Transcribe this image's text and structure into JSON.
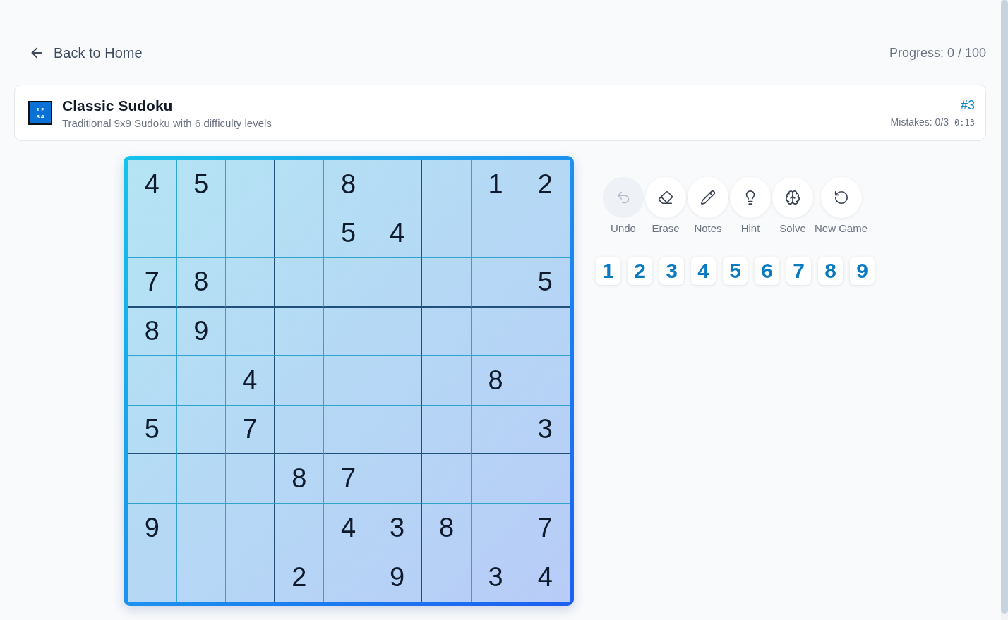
{
  "header": {
    "back_link": "Back to Home",
    "progress": "Progress: 0 / 100"
  },
  "game_card": {
    "logo_lines": [
      "1 2",
      "3 4"
    ],
    "title": "Classic Sudoku",
    "subtitle": "Traditional 9x9 Sudoku with 6 difficulty levels",
    "puzzle_number": "#3",
    "mistakes": "Mistakes: 0/3",
    "timer": "0:13"
  },
  "board": {
    "rows": [
      [
        "4",
        "5",
        null,
        null,
        "8",
        null,
        null,
        "1",
        "2"
      ],
      [
        null,
        null,
        null,
        null,
        "5",
        "4",
        null,
        null,
        null
      ],
      [
        "7",
        "8",
        null,
        null,
        null,
        null,
        null,
        null,
        "5"
      ],
      [
        "8",
        "9",
        null,
        null,
        null,
        null,
        null,
        null,
        null
      ],
      [
        null,
        null,
        "4",
        null,
        null,
        null,
        null,
        "8",
        null
      ],
      [
        "5",
        null,
        "7",
        null,
        null,
        null,
        null,
        null,
        "3"
      ],
      [
        null,
        null,
        null,
        "8",
        "7",
        null,
        null,
        null,
        null
      ],
      [
        "9",
        null,
        null,
        null,
        "4",
        "3",
        "8",
        null,
        "7"
      ],
      [
        null,
        null,
        null,
        "2",
        null,
        "9",
        null,
        "3",
        "4"
      ]
    ]
  },
  "tools": [
    {
      "kind": "undo",
      "label": "Undo",
      "disabled": true
    },
    {
      "kind": "erase",
      "label": "Erase",
      "disabled": false
    },
    {
      "kind": "notes",
      "label": "Notes",
      "disabled": false
    },
    {
      "kind": "hint",
      "label": "Hint",
      "disabled": false
    },
    {
      "kind": "solve",
      "label": "Solve",
      "disabled": false
    },
    {
      "kind": "restart",
      "label": "New Game",
      "disabled": false
    }
  ],
  "number_pad": [
    "1",
    "2",
    "3",
    "4",
    "5",
    "6",
    "7",
    "8",
    "9"
  ]
}
